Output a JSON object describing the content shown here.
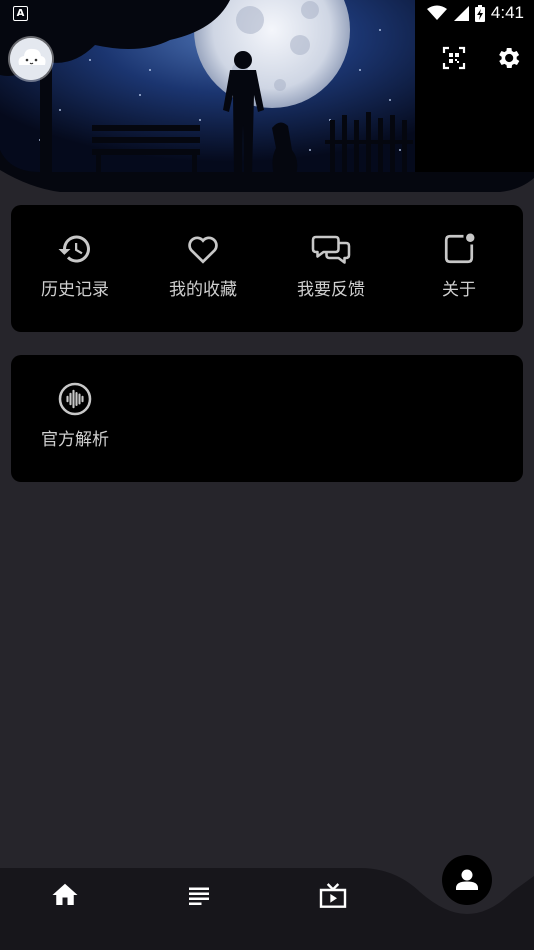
{
  "status_bar": {
    "notification_letter": "A",
    "time": "4:41",
    "icons": [
      "wifi-icon",
      "cellular-signal-icon",
      "battery-charging-icon"
    ]
  },
  "header": {
    "avatar_icon": "cloud-avatar-icon",
    "scan_icon": "qr-scan-icon",
    "settings_icon": "gear-icon"
  },
  "quick_menu": {
    "items": [
      {
        "label": "历史记录",
        "icon": "history-icon"
      },
      {
        "label": "我的收藏",
        "icon": "heart-icon"
      },
      {
        "label": "我要反馈",
        "icon": "feedback-chat-icon"
      },
      {
        "label": "关于",
        "icon": "about-icon"
      }
    ]
  },
  "tools_menu": {
    "items": [
      {
        "label": "官方解析",
        "icon": "audio-wave-icon"
      }
    ]
  },
  "bottom_nav": {
    "items": [
      {
        "icon": "home-icon",
        "active": true
      },
      {
        "icon": "list-icon",
        "active": false
      },
      {
        "icon": "tv-play-icon",
        "active": false
      }
    ],
    "fab_icon": "person-icon"
  },
  "colors": {
    "background": "#26252b",
    "card": "#000000",
    "text": "#cfcfcf",
    "icon": "#c8c8c8"
  }
}
